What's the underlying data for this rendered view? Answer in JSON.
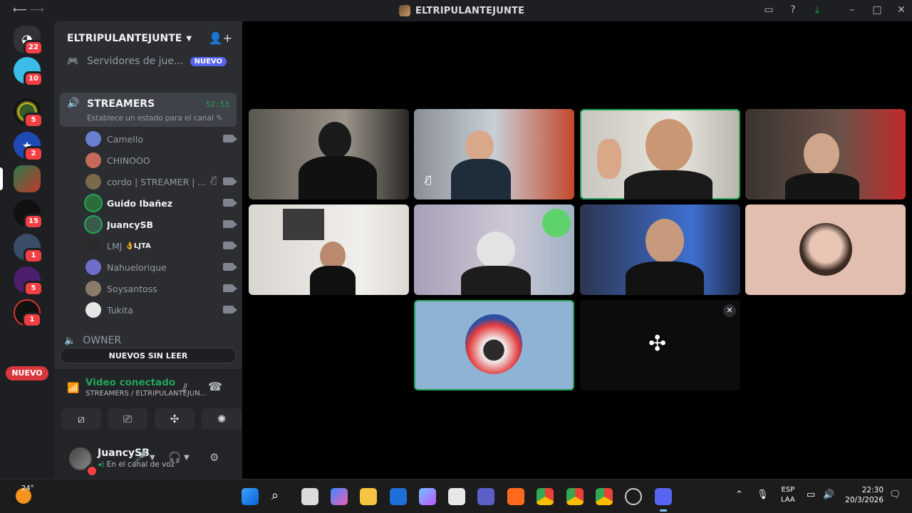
{
  "window": {
    "title": "ELTRIPULANTEJUNTE",
    "colors": {
      "accent": "#5865f2",
      "online": "#23a55a",
      "danger": "#f23f43",
      "bg": "#1e1f22"
    }
  },
  "rail": {
    "items": [
      {
        "name": "direct-messages",
        "badge": "22"
      },
      {
        "name": "server-1",
        "badge": "10"
      },
      {
        "name": "server-2",
        "badge": "5"
      },
      {
        "name": "server-3",
        "badge": "2"
      },
      {
        "name": "server-eltripulantejunte",
        "badge": ""
      },
      {
        "name": "server-5",
        "badge": "15"
      },
      {
        "name": "server-6",
        "badge": "1"
      },
      {
        "name": "server-7",
        "badge": "5"
      },
      {
        "name": "server-8",
        "badge": "1"
      }
    ],
    "nuevo_label": "NUEVO"
  },
  "server": {
    "name": "ELTRIPULANTEJUNTE",
    "games_channel": "Servidores de jue...",
    "games_badge": "NUEVO",
    "voice_channel": {
      "name": "STREAMERS",
      "timer": "52:53",
      "status_hint": "Establece un estado para el canal"
    },
    "members": [
      {
        "name": "Camello",
        "bold": false,
        "tag": "",
        "muted": false,
        "cam": true
      },
      {
        "name": "CHINOOO",
        "bold": false,
        "tag": "",
        "muted": false,
        "cam": false
      },
      {
        "name": "cordo | STREAMER | ...",
        "bold": false,
        "tag": "",
        "muted": true,
        "cam": true
      },
      {
        "name": "Guido Ibañez",
        "bold": true,
        "tag": "",
        "muted": false,
        "cam": true
      },
      {
        "name": "JuancySB",
        "bold": true,
        "tag": "",
        "muted": false,
        "cam": true
      },
      {
        "name": "LMJ",
        "bold": false,
        "tag": "👌LJTA",
        "muted": false,
        "cam": true
      },
      {
        "name": "Nahuelorique",
        "bold": false,
        "tag": "",
        "muted": false,
        "cam": true
      },
      {
        "name": "Soysantoss",
        "bold": false,
        "tag": "",
        "muted": false,
        "cam": true
      },
      {
        "name": "Tukita",
        "bold": false,
        "tag": "",
        "muted": false,
        "cam": true
      }
    ],
    "owner_channel": "OWNER",
    "unread_pill": "NUEVOS SIN LEER"
  },
  "voice_panel": {
    "connected": "Video conectado",
    "path": "STREAMERS / ELTRIPULANTEJUN..."
  },
  "user_panel": {
    "username": "JuancySB",
    "status": "En el canal de voz"
  },
  "taskbar": {
    "temperature": "24°",
    "lang_line1": "ESP",
    "lang_line2": "LAA",
    "time": "22:30",
    "date": "20/3/2026"
  }
}
